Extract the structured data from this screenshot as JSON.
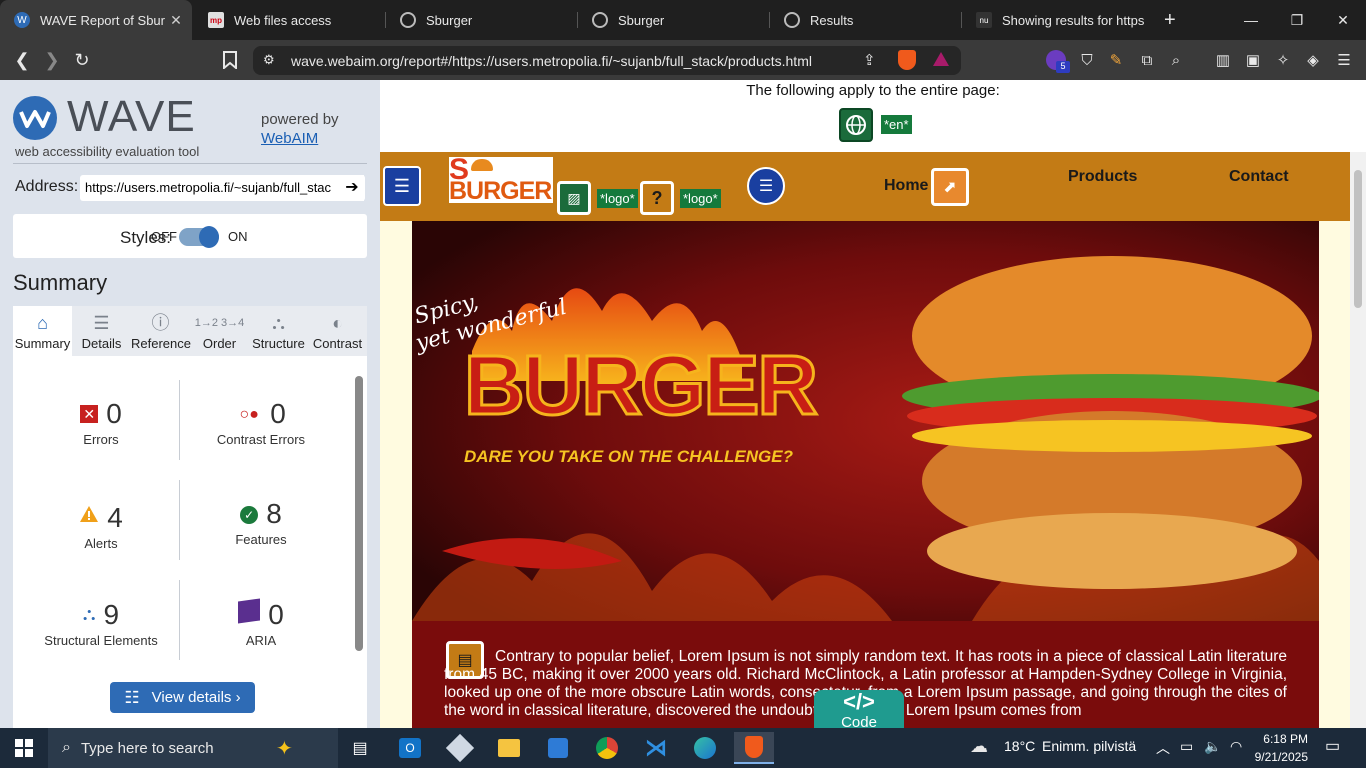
{
  "browser": {
    "tabs": [
      {
        "title": "WAVE Report of Sburg",
        "active": true
      },
      {
        "title": "Web files access"
      },
      {
        "title": "Sburger"
      },
      {
        "title": "Sburger"
      },
      {
        "title": "Results"
      },
      {
        "title": "Showing results for https://"
      }
    ],
    "new_tab": "+",
    "url": "wave.webaim.org/report#/https://users.metropolia.fi/~sujanb/full_stack/products.html",
    "ext_badge": "5"
  },
  "wave": {
    "logo_text": "WAVE",
    "tagline": "web accessibility evaluation tool",
    "powered_by": "powered by",
    "webaim": "WebAIM",
    "address_label": "Address:",
    "address_value": "https://users.metropolia.fi/~sujanb/full_stac",
    "styles_label": "Styles:",
    "styles_off": "OFF",
    "styles_on": "ON",
    "summary_heading": "Summary",
    "tabs": [
      "Summary",
      "Details",
      "Reference",
      "Order",
      "Structure",
      "Contrast"
    ],
    "stats": [
      {
        "count": "0",
        "label": "Errors"
      },
      {
        "count": "0",
        "label": "Contrast Errors"
      },
      {
        "count": "4",
        "label": "Alerts"
      },
      {
        "count": "8",
        "label": "Features"
      },
      {
        "count": "9",
        "label": "Structural Elements"
      },
      {
        "count": "0",
        "label": "ARIA"
      }
    ],
    "view_details": "View details ›"
  },
  "page": {
    "apply_text": "The following apply to the entire page:",
    "lang_tag": "*en*",
    "logo_alt_1": "*logo*",
    "logo_alt_2": "*logo*",
    "logo_s": "S",
    "logo_burger": "BURGER",
    "nav": {
      "home": "Home",
      "products": "Products",
      "contact": "Contact"
    },
    "hero": {
      "tagline_1": "Spicy,",
      "tagline_2": "yet wonderful",
      "title": "BURGER",
      "subtitle": "DARE YOU TAKE ON THE CHALLENGE?"
    },
    "paragraph": "Contrary to popular belief, Lorem Ipsum is not simply random text. It has roots in a piece of classical Latin literature from 45 BC, making it over 2000 years old. Richard McClintock, a Latin professor at Hampden-Sydney College in Virginia, looked up one of the more obscure Latin words, consectetur, from a Lorem Ipsum passage, and going through the cites of the word in classical literature, discovered the undoubtable source. Lorem Ipsum comes from",
    "code_button": "Code",
    "code_glyph": "</>"
  },
  "taskbar": {
    "search_placeholder": "Type here to search",
    "weather_temp": "18°C",
    "weather_desc": "Enimm. pilvistä",
    "time": "6:18 PM",
    "date": "9/21/2025"
  }
}
